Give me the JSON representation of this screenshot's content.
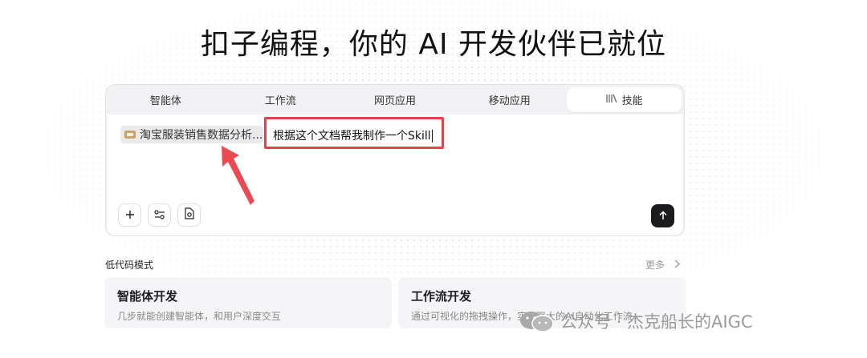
{
  "hero": {
    "title": "扣子编程，你的 AI 开发伙伴已就位"
  },
  "tabs": [
    {
      "label": "智能体",
      "icon": ""
    },
    {
      "label": "工作流",
      "icon": ""
    },
    {
      "label": "网页应用",
      "icon": ""
    },
    {
      "label": "移动应用",
      "icon": ""
    },
    {
      "label": "技能",
      "icon": "books-icon",
      "active": true
    }
  ],
  "composer": {
    "file_chip_label": "淘宝服装销售数据分析...",
    "input_value": "根据这个文档帮我制作一个Skill",
    "tool_icons": [
      "plus-icon",
      "settings-sliders-icon",
      "file-gear-icon"
    ],
    "send_icon": "arrow-up-icon"
  },
  "lowcode": {
    "title": "低代码模式",
    "more_label": "更多",
    "cards": [
      {
        "title": "智能体开发",
        "desc": "几步就能创建智能体，和用户深度交互"
      },
      {
        "title": "工作流开发",
        "desc": "通过可视化的拖拽操作，实现强大的AI自动化工作流"
      }
    ]
  },
  "watermark": {
    "text": "公众号 · 杰克船长的AIGC"
  },
  "colors": {
    "highlight": "#e8414a",
    "send_button": "#1b1b1d",
    "card_bg": "#f5f5f7"
  }
}
